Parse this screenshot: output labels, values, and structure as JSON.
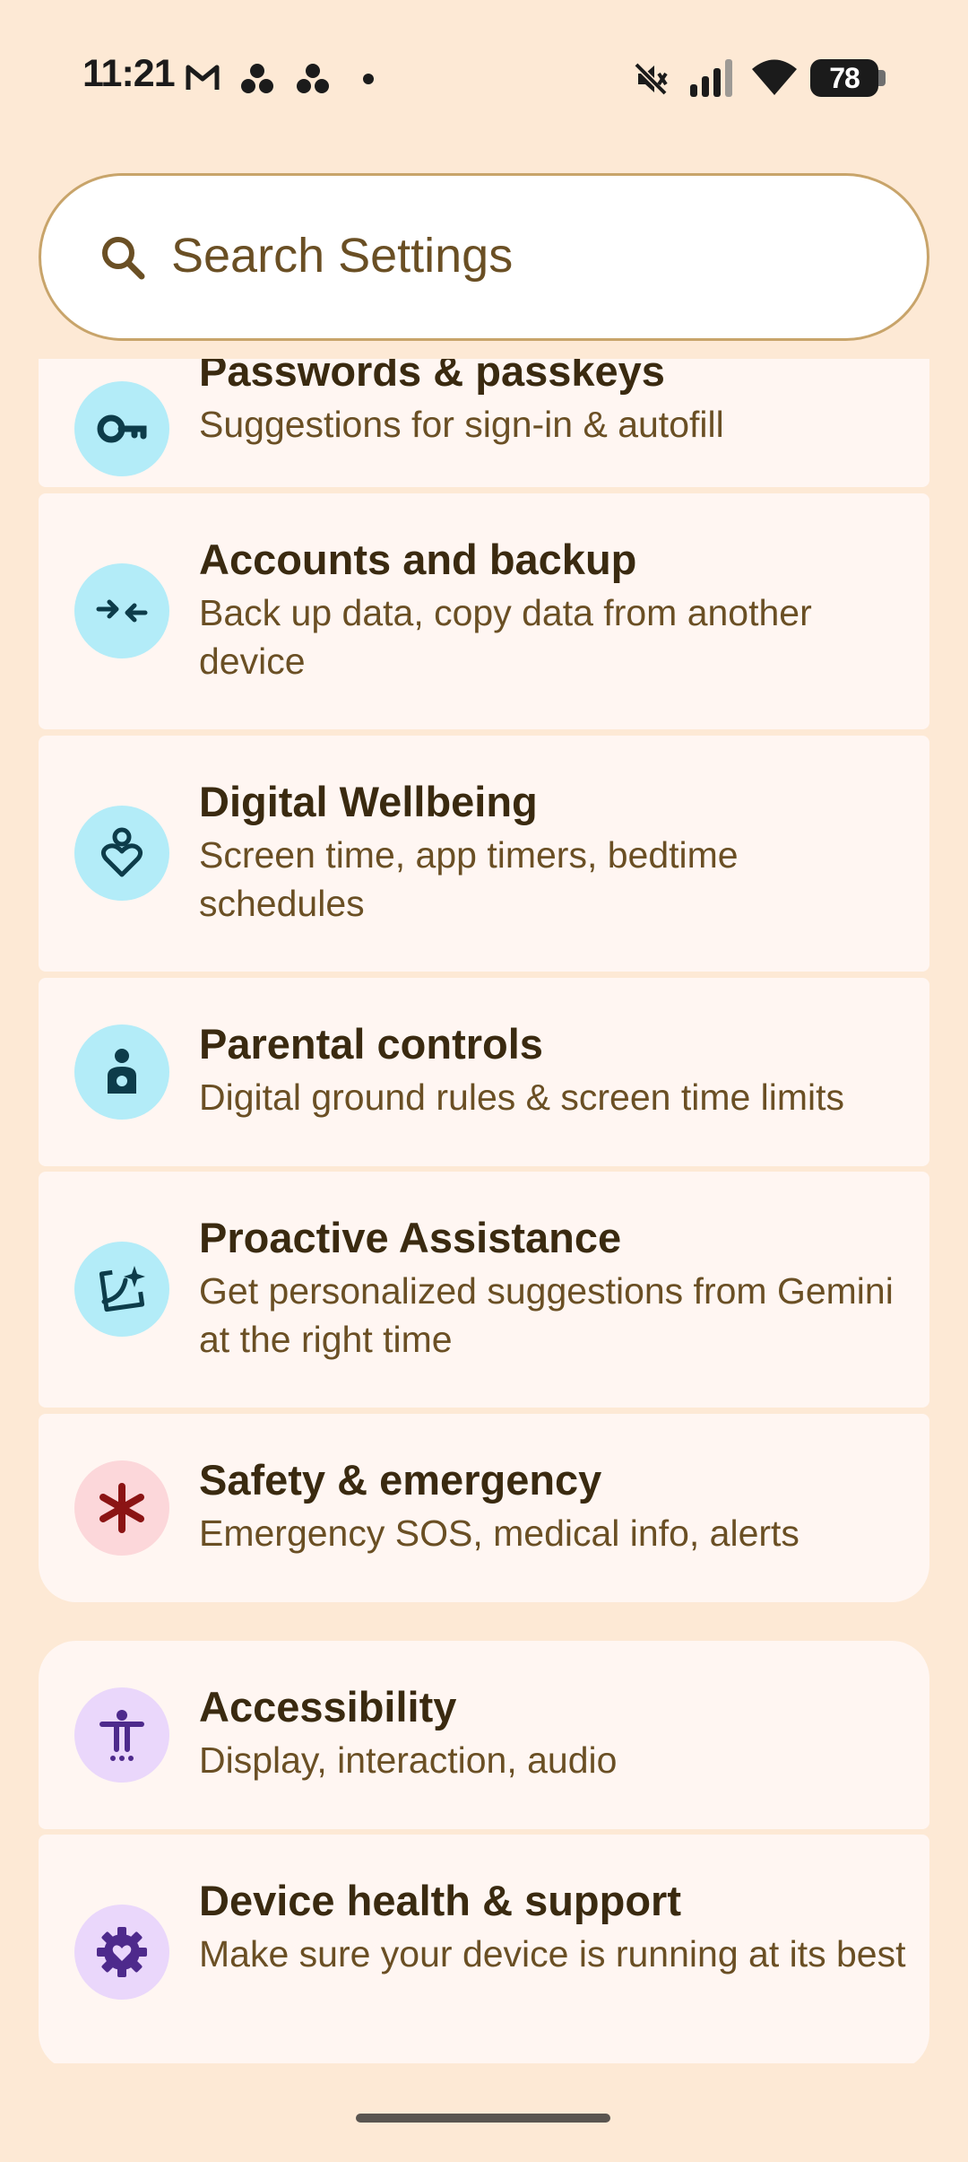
{
  "status_bar": {
    "time": "11:21",
    "battery": "78",
    "icons": [
      "gmail-icon",
      "notification-dots-icon",
      "notification-dots-icon",
      "dot-icon",
      "mute-icon",
      "signal-icon",
      "wifi-icon",
      "battery-icon"
    ]
  },
  "search": {
    "placeholder": "Search Settings",
    "icon": "search-icon"
  },
  "items": [
    {
      "title": "Passwords & passkeys",
      "subtitle": "Suggestions for sign-in & autofill",
      "icon": "key-icon",
      "icon_bg": "#b3ecf8",
      "icon_color": "#0d3c4a"
    },
    {
      "title": "Accounts and backup",
      "subtitle": "Back up data, copy data from another device",
      "icon": "sync-arrows-icon",
      "icon_bg": "#b3ecf8",
      "icon_color": "#0d3c4a"
    },
    {
      "title": "Digital Wellbeing",
      "subtitle": "Screen time, app timers, bedtime schedules",
      "icon": "wellbeing-icon",
      "icon_bg": "#b3ecf8",
      "icon_color": "#0d3c4a"
    },
    {
      "title": "Parental controls",
      "subtitle": "Digital ground rules & screen time limits",
      "icon": "parental-icon",
      "icon_bg": "#b3ecf8",
      "icon_color": "#0d3c4a"
    },
    {
      "title": "Proactive Assistance",
      "subtitle": "Get personalized suggestions from Gemini at the right time",
      "icon": "assistant-sparkle-icon",
      "icon_bg": "#b3ecf8",
      "icon_color": "#0d3c4a"
    },
    {
      "title": "Safety & emergency",
      "subtitle": "Emergency SOS, medical info, alerts",
      "icon": "asterisk-icon",
      "icon_bg": "#fcd7da",
      "icon_color": "#8b1414"
    },
    {
      "title": "Accessibility",
      "subtitle": "Display, interaction, audio",
      "icon": "accessibility-icon",
      "icon_bg": "#ead7fb",
      "icon_color": "#4e2a8c"
    },
    {
      "title": "Device health & support",
      "subtitle": "Make sure your device is running at its best",
      "icon": "gear-heart-icon",
      "icon_bg": "#ead7fb",
      "icon_color": "#4e2a8c"
    }
  ]
}
